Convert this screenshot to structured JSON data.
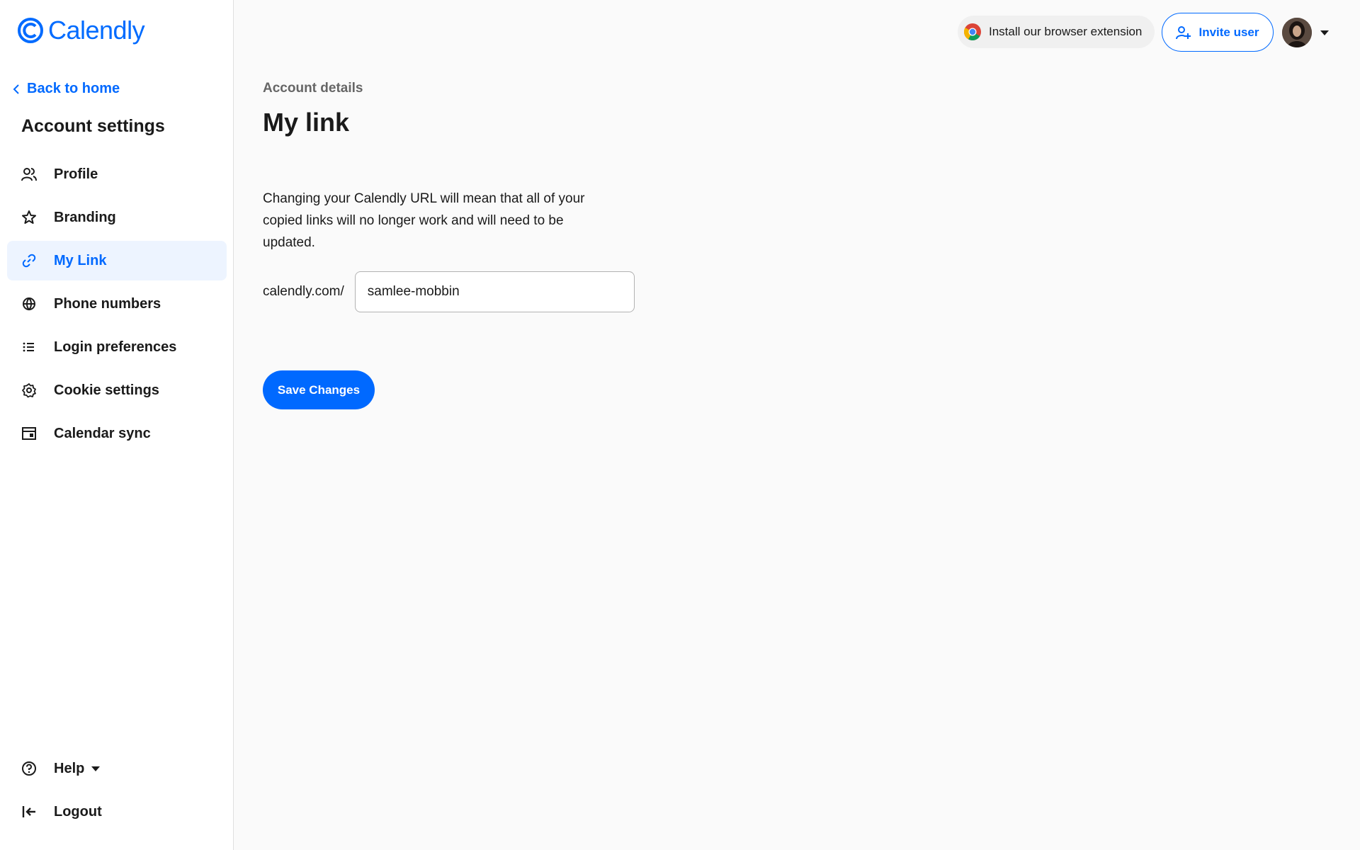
{
  "brand": {
    "name": "Calendly",
    "color": "#006bff"
  },
  "sidebar": {
    "back_label": "Back to home",
    "title": "Account settings",
    "items": [
      {
        "label": "Profile",
        "icon": "profile-icon"
      },
      {
        "label": "Branding",
        "icon": "star-icon"
      },
      {
        "label": "My Link",
        "icon": "link-icon",
        "active": true
      },
      {
        "label": "Phone numbers",
        "icon": "globe-icon"
      },
      {
        "label": "Login preferences",
        "icon": "list-icon"
      },
      {
        "label": "Cookie settings",
        "icon": "gear-icon"
      },
      {
        "label": "Calendar sync",
        "icon": "calendar-icon"
      }
    ],
    "bottom": [
      {
        "label": "Help",
        "icon": "help-icon"
      },
      {
        "label": "Logout",
        "icon": "logout-icon"
      }
    ]
  },
  "topbar": {
    "extension_label": "Install our browser extension",
    "invite_label": "Invite user"
  },
  "main": {
    "breadcrumb": "Account details",
    "title": "My link",
    "description": "Changing your Calendly URL will mean that all of your copied links will no longer work and will need to be updated.",
    "url_prefix": "calendly.com/",
    "url_value": "samlee-mobbin",
    "save_label": "Save Changes"
  },
  "colors": {
    "accent": "#0069ff",
    "active_bg": "#edf4ff"
  }
}
